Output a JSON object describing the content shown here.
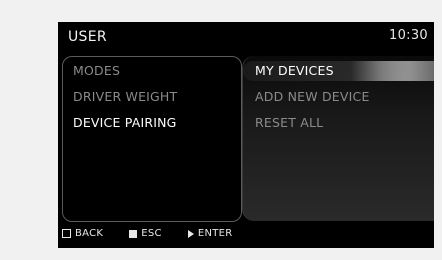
{
  "header": {
    "title": "USER",
    "clock": "10:30"
  },
  "left_menu": {
    "items": [
      {
        "label": "MODES",
        "state": "dim"
      },
      {
        "label": "DRIVER WEIGHT",
        "state": "dim"
      },
      {
        "label": "DEVICE PAIRING",
        "state": "active"
      }
    ]
  },
  "right_menu": {
    "items": [
      {
        "label": "MY DEVICES",
        "state": "selected"
      },
      {
        "label": "ADD NEW DEVICE",
        "state": "dim"
      },
      {
        "label": "RESET ALL",
        "state": "dim"
      }
    ]
  },
  "footer": {
    "back_label": "BACK",
    "esc_label": "ESC",
    "enter_label": "ENTER"
  },
  "colors": {
    "background": "#000000",
    "text_active": "#ffffff",
    "text_dim": "#8a8a8a",
    "frame": "#f1f1f1"
  }
}
